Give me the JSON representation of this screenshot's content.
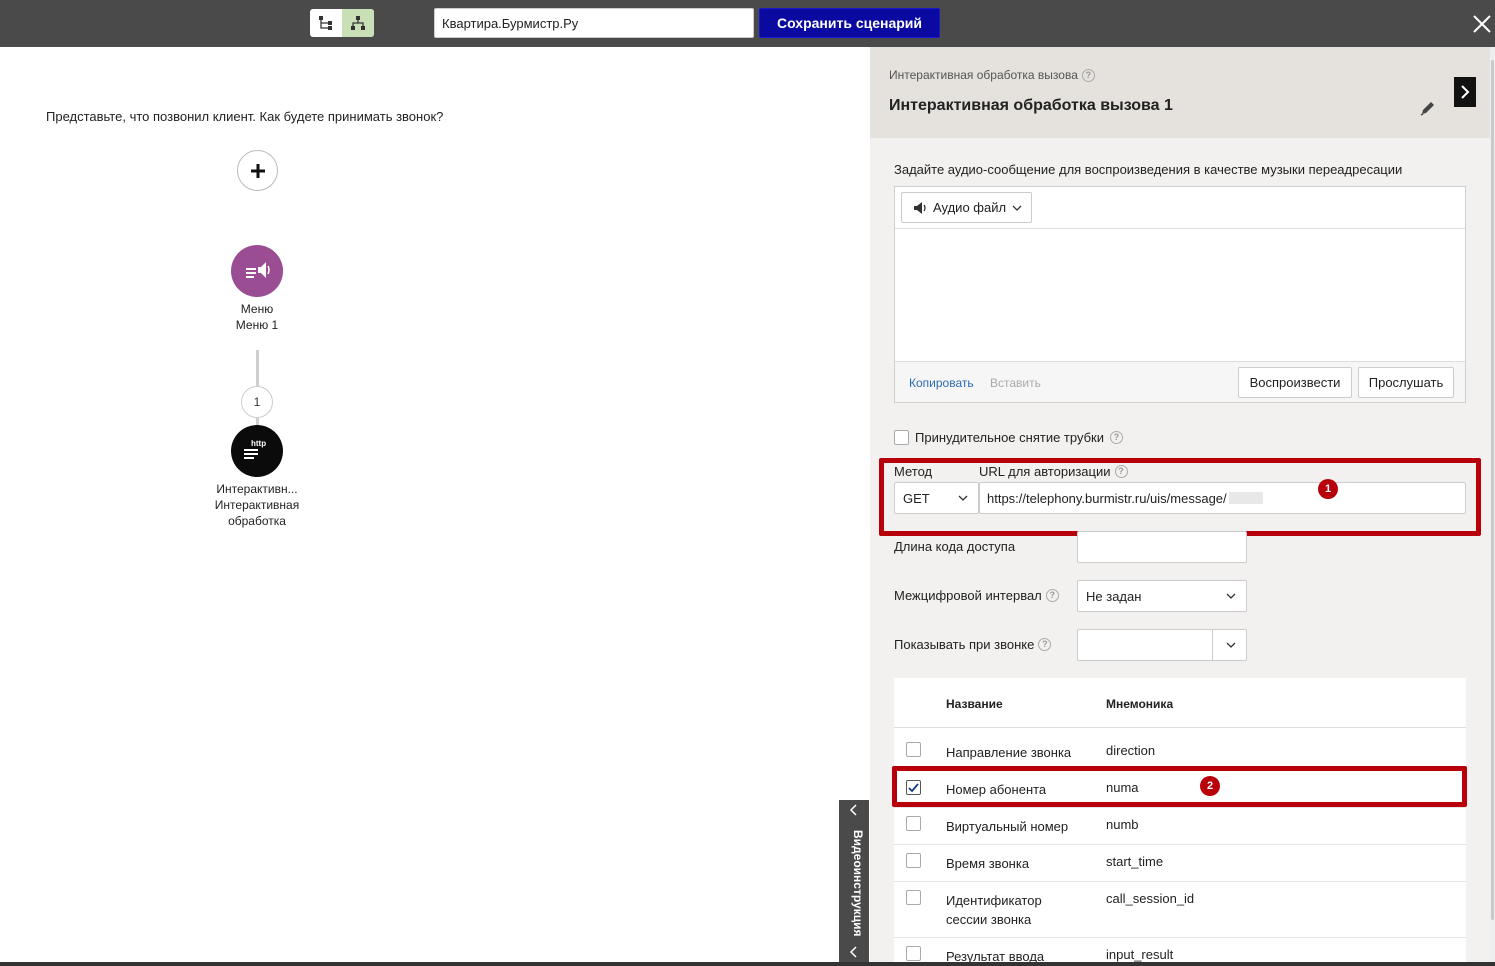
{
  "topbar": {
    "scenario_name": "Квартира.Бурмистр.Ру",
    "save_label": "Сохранить сценарий"
  },
  "canvas": {
    "prompt": "Представьте, что позвонил клиент. Как будете принимать звонок?",
    "menu_node": {
      "line1": "Меню",
      "line2": "Меню 1"
    },
    "branch_number": "1",
    "http_node": {
      "badge": "http",
      "line1": "Интерактивн...",
      "line2": "Интерактивная",
      "line3": "обработка"
    },
    "video_tab_label": "Видеоинструкция"
  },
  "panel": {
    "subtitle": "Интерактивная обработка вызова",
    "title": "Интерактивная обработка вызова 1",
    "audio": {
      "caption": "Задайте аудио-сообщение для воспроизведения в качестве музыки переадресации",
      "source_label": "Аудио файл",
      "copy_label": "Копировать",
      "paste_label": "Вставить",
      "play_label": "Воспроизвести",
      "listen_label": "Прослушать"
    },
    "force_pickup": {
      "label": "Принудительное снятие трубки",
      "checked": false
    },
    "method": {
      "label": "Метод",
      "value": "GET"
    },
    "auth_url": {
      "label": "URL для авторизации",
      "value": "https://telephony.burmistr.ru/uis/message/"
    },
    "access_code_length": {
      "label": "Длина кода доступа",
      "value": ""
    },
    "interdigit_interval": {
      "label": "Межцифровой интервал",
      "value": "Не задан"
    },
    "show_on_call": {
      "label": "Показывать при звонке",
      "value": ""
    },
    "markers": {
      "first": "1",
      "second": "2"
    },
    "params_table": {
      "headers": {
        "name": "Название",
        "mnemonic": "Мнемоника"
      },
      "rows": [
        {
          "name": "Направление звонка",
          "mnemonic": "direction",
          "checked": false
        },
        {
          "name": "Номер абонента",
          "mnemonic": "numa",
          "checked": true
        },
        {
          "name": "Виртуальный номер",
          "mnemonic": "numb",
          "checked": false
        },
        {
          "name": "Время звонка",
          "mnemonic": "start_time",
          "checked": false
        },
        {
          "name": "Идентификатор сессии звонка",
          "mnemonic": "call_session_id",
          "checked": false
        },
        {
          "name": "Результат ввода",
          "mnemonic": "input_result",
          "checked": false
        }
      ]
    }
  },
  "colors": {
    "topbar": "#4a4a4a",
    "save_button": "#0a0aa0",
    "menu_node": "#9a4d93",
    "http_node": "#0b0b0b",
    "highlight": "#b8000b",
    "link": "#2a6bb5"
  }
}
